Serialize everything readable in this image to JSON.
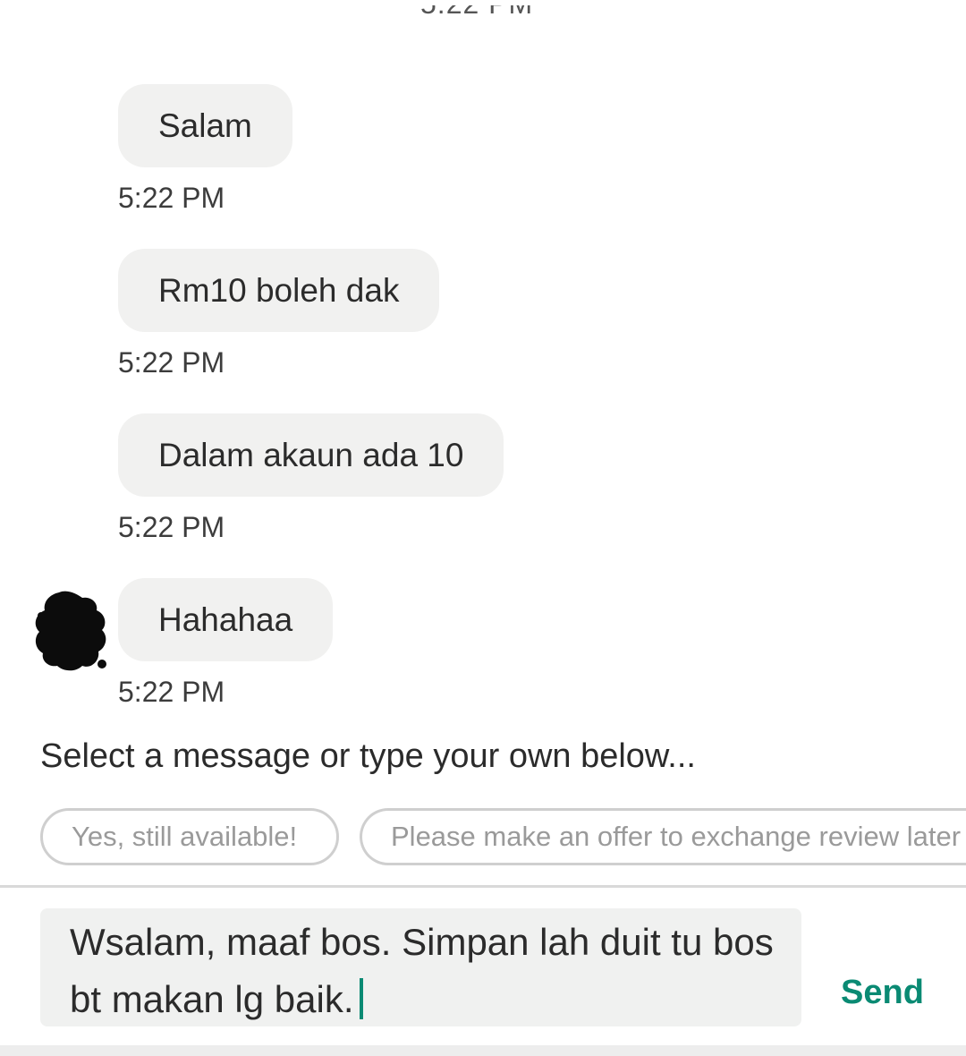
{
  "header": {
    "partial_time": "5:22 PM"
  },
  "messages": [
    {
      "text": "Salam",
      "time": "5:22 PM"
    },
    {
      "text": "Rm10 boleh dak",
      "time": "5:22 PM"
    },
    {
      "text": "Dalam akaun ada 10",
      "time": "5:22 PM"
    },
    {
      "text": "Hahahaa",
      "time": "5:22 PM"
    }
  ],
  "quick_replies": {
    "prompt": "Select a message or type your own below...",
    "chips": [
      "Yes, still available!",
      "Please make an offer to exchange review later"
    ]
  },
  "composer": {
    "value": "Wsalam, maaf bos. Simpan lah duit tu bos bt makan lg baik.",
    "send_label": "Send"
  },
  "colors": {
    "accent": "#0a8a73",
    "bubble": "#f1f1f0",
    "input_bg": "#f0f1f0"
  }
}
